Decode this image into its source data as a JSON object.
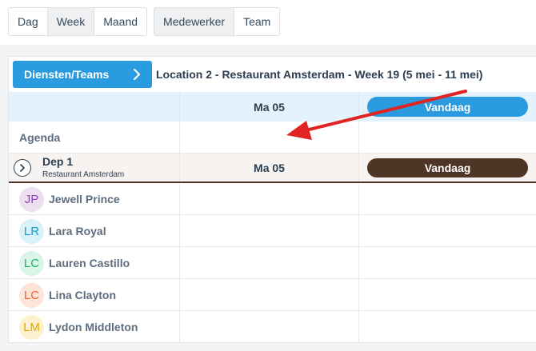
{
  "view_toggles": {
    "period": [
      {
        "label": "Dag",
        "active": false
      },
      {
        "label": "Week",
        "active": true
      },
      {
        "label": "Maand",
        "active": false
      }
    ],
    "grouping": [
      {
        "label": "Medewerker",
        "active": true
      },
      {
        "label": "Team",
        "active": false
      }
    ]
  },
  "header": {
    "diensten_button": "Diensten/Teams",
    "location_title": "Location 2 - Restaurant Amsterdam - Week 19 (5 mei - 11 mei)"
  },
  "date_row": {
    "day_label": "Ma 05",
    "today_label": "Vandaag"
  },
  "agenda": {
    "label": "Agenda"
  },
  "department": {
    "name": "Dep 1",
    "location": "Restaurant Amsterdam",
    "day_label": "Ma 05",
    "today_label": "Vandaag"
  },
  "employees": [
    {
      "initials": "JP",
      "name": "Jewell Prince",
      "avatar_bg": "#ece0f0",
      "avatar_fg": "#8e44ad"
    },
    {
      "initials": "LR",
      "name": "Lara Royal",
      "avatar_bg": "#d9f1f9",
      "avatar_fg": "#1a9bc9"
    },
    {
      "initials": "LC",
      "name": "Lauren Castillo",
      "avatar_bg": "#d8f5e8",
      "avatar_fg": "#27ae60"
    },
    {
      "initials": "LC",
      "name": "Lina Clayton",
      "avatar_bg": "#fde3d8",
      "avatar_fg": "#e8672e"
    },
    {
      "initials": "LM",
      "name": "Lydon Middleton",
      "avatar_bg": "#fdf2cf",
      "avatar_fg": "#e0a800"
    }
  ],
  "colors": {
    "primary": "#2b9be0",
    "department_dark": "#4e3526",
    "annotation_arrow": "#e02424"
  },
  "icons": {
    "diensten_button": "chevron-right-icon",
    "department_toggle": "chevron-right-circle-icon"
  }
}
